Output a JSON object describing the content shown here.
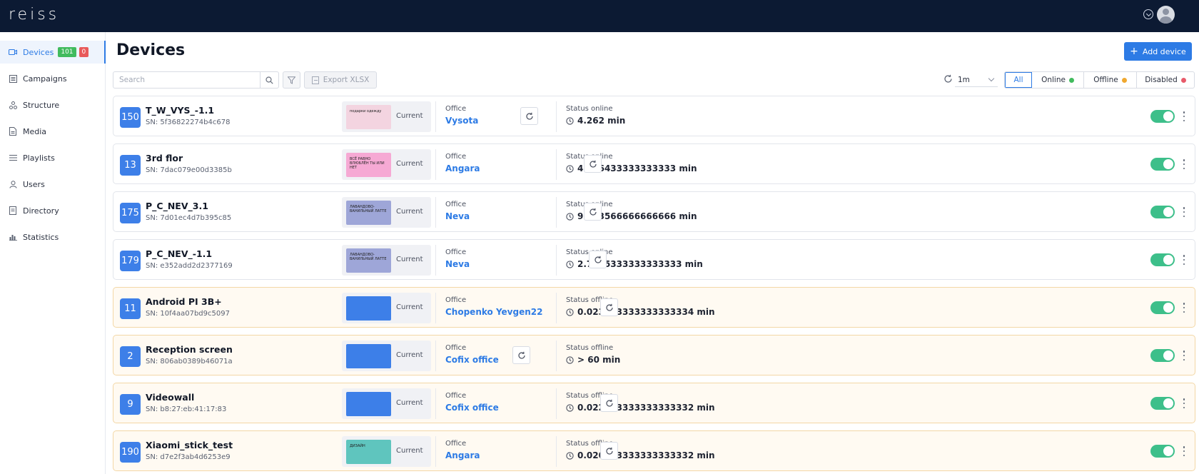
{
  "app": {
    "logo": "reiss"
  },
  "sidebar": {
    "items": [
      {
        "label": "Devices",
        "icon": "camera-icon",
        "badge_online": "101",
        "badge_offline": "0"
      },
      {
        "label": "Campaigns",
        "icon": "campaign-icon"
      },
      {
        "label": "Structure",
        "icon": "structure-icon"
      },
      {
        "label": "Media",
        "icon": "media-icon"
      },
      {
        "label": "Playlists",
        "icon": "playlist-icon"
      },
      {
        "label": "Users",
        "icon": "user-icon"
      },
      {
        "label": "Directory",
        "icon": "directory-icon"
      },
      {
        "label": "Statistics",
        "icon": "statistics-icon"
      }
    ]
  },
  "main": {
    "title": "Devices",
    "add_button": "Add device",
    "search_placeholder": "Search",
    "export_label": "Export XLSX",
    "interval": "1m",
    "status_filters": [
      {
        "label": "All",
        "active": true
      },
      {
        "label": "Online",
        "color": "#41bb5e"
      },
      {
        "label": "Offline",
        "color": "#f0a830"
      },
      {
        "label": "Disabled",
        "color": "#e85a6a"
      }
    ]
  },
  "devices": [
    {
      "num": "150",
      "name": "T_W_VYS_-1.1",
      "sn": "SN: 5f36822274b4c678",
      "preview": "Current",
      "office_label": "Office",
      "office": "Vysota",
      "status_label": "Status online",
      "status": "4.262 min",
      "offline": false,
      "enabled": true
    },
    {
      "num": "13",
      "name": "3rd flor",
      "sn": "SN: 7dac079e00d3385b",
      "preview": "Current",
      "office_label": "Office",
      "office": "Angara",
      "status_label": "Status online",
      "status": "4.076433333333333 min",
      "offline": false,
      "enabled": true
    },
    {
      "num": "175",
      "name": "P_C_NEV_3.1",
      "sn": "SN: 7d01ec4d7b395c85",
      "preview": "Current",
      "office_label": "Office",
      "office": "Neva",
      "status_label": "Status online",
      "status": "9.843566666666666 min",
      "offline": false,
      "enabled": true
    },
    {
      "num": "179",
      "name": "P_C_NEV_-1.1",
      "sn": "SN: e352add2d2377169",
      "preview": "Current",
      "office_label": "Office",
      "office": "Neva",
      "status_label": "Status online",
      "status": "2.7785333333333333 min",
      "offline": false,
      "enabled": true
    },
    {
      "num": "11",
      "name": "Android PI 3B+",
      "sn": "SN: 10f4aa07bd9c5097",
      "preview": "Current",
      "office_label": "Office",
      "office": "Chopenko Yevgen22",
      "status_label": "Status offline",
      "status": "0.023083333333333334 min",
      "offline": true,
      "enabled": true
    },
    {
      "num": "2",
      "name": "Reception screen",
      "sn": "SN: 806ab0389b46071a",
      "preview": "Current",
      "office_label": "Office",
      "office": "Cofix office",
      "status_label": "Status offline",
      "status": "> 60 min",
      "offline": true,
      "enabled": true
    },
    {
      "num": "9",
      "name": "Videowall",
      "sn": "SN: b8:27:eb:41:17:83",
      "preview": "Current",
      "office_label": "Office",
      "office": "Cofix office",
      "status_label": "Status offline",
      "status": "0.022533333333333332 min",
      "offline": true,
      "enabled": true
    },
    {
      "num": "190",
      "name": "Xiaomi_stick_test",
      "sn": "SN: d7e2f3ab4d6253e9",
      "preview": "Current",
      "office_label": "Office",
      "office": "Angara",
      "status_label": "Status offline",
      "status": "0.020833333333333332 min",
      "offline": true,
      "enabled": true
    }
  ],
  "thumbnails": [
    {
      "style": "pink-tall",
      "text": "подарки одежду"
    },
    {
      "style": "pink",
      "text": "ВСЁ РАВНО ВЛЮБЛЁН ТЫ ИЛИ НЕТ"
    },
    {
      "style": "lav",
      "text": "ЛАВАНДОВО-ВАНИЛЬНЫЙ ЛАТТЕ"
    },
    {
      "style": "lav",
      "text": "ЛАВАНДОВО-ВАНИЛЬНЫЙ ЛАТТЕ"
    },
    {
      "style": "blue",
      "text": ""
    },
    {
      "style": "blue",
      "text": ""
    },
    {
      "style": "blue",
      "text": ""
    },
    {
      "style": "teal",
      "text": "ДИЗАЙН"
    }
  ],
  "colors": {
    "topbar": "#0c1a33",
    "accent": "#2d7be5",
    "toggle": "#3dbf8a",
    "offline_bg": "#fffaf2"
  }
}
